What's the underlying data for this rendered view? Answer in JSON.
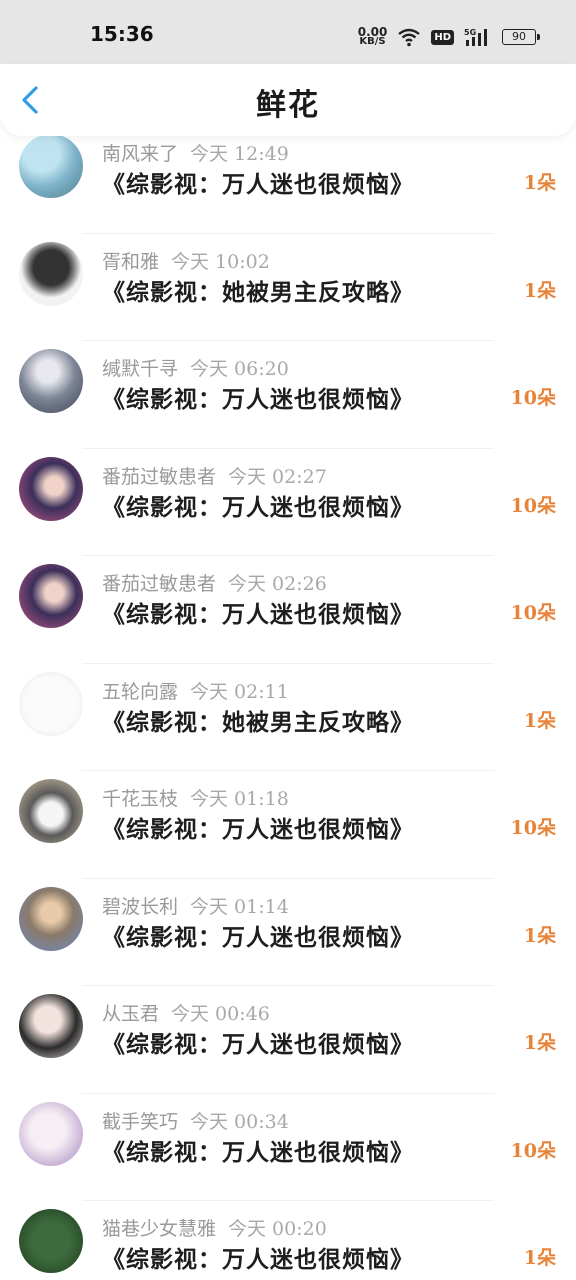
{
  "status_bar": {
    "time": "15:36",
    "net_speed_value": "0.00",
    "net_speed_unit": "KB/S",
    "hd_label": "HD",
    "signal_label": "5G",
    "battery": "90"
  },
  "header": {
    "title": "鲜花",
    "back_icon": "chevron-left-icon",
    "accent_color": "#2f9de8"
  },
  "items": [
    {
      "user": "南风来了",
      "time": "今天 12:49",
      "book": "《综影视：万人迷也很烦恼》",
      "count": "1朵"
    },
    {
      "user": "胥和雅",
      "time": "今天 10:02",
      "book": "《综影视：她被男主反攻略》",
      "count": "1朵"
    },
    {
      "user": "缄默千寻",
      "time": "今天 06:20",
      "book": "《综影视：万人迷也很烦恼》",
      "count": "10朵"
    },
    {
      "user": "番茄过敏患者",
      "time": "今天 02:27",
      "book": "《综影视：万人迷也很烦恼》",
      "count": "10朵"
    },
    {
      "user": "番茄过敏患者",
      "time": "今天 02:26",
      "book": "《综影视：万人迷也很烦恼》",
      "count": "10朵"
    },
    {
      "user": "五轮向露",
      "time": "今天 02:11",
      "book": "《综影视：她被男主反攻略》",
      "count": "1朵"
    },
    {
      "user": "千花玉枝",
      "time": "今天 01:18",
      "book": "《综影视：万人迷也很烦恼》",
      "count": "10朵"
    },
    {
      "user": "碧波长利",
      "time": "今天 01:14",
      "book": "《综影视：万人迷也很烦恼》",
      "count": "1朵"
    },
    {
      "user": "从玉君",
      "time": "今天 00:46",
      "book": "《综影视：万人迷也很烦恼》",
      "count": "1朵"
    },
    {
      "user": "截手笑巧",
      "time": "今天 00:34",
      "book": "《综影视：万人迷也很烦恼》",
      "count": "10朵"
    },
    {
      "user": "猫巷少女慧雅",
      "time": "今天 00:20",
      "book": "《综影视：万人迷也很烦恼》",
      "count": "1朵"
    }
  ],
  "colors": {
    "count": "#e8843a",
    "username": "#9a9a9a",
    "book": "#1e1e1e"
  }
}
